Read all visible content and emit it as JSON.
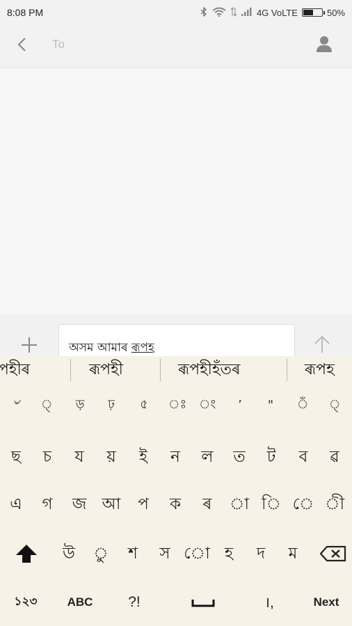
{
  "status": {
    "time": "8:08 PM",
    "network": "4G VoLTE",
    "battery_text": "50%",
    "battery_level": 0.5
  },
  "header": {
    "recipient_placeholder": "To"
  },
  "compose": {
    "text_before": "অসম আমাৰ ",
    "text_current": "ৰূপহ"
  },
  "suggestions": [
    "পহীৰ",
    "ৰূপহী",
    "ৰূপহীহঁতৰ",
    "ৰূপহ"
  ],
  "keyboard": {
    "row0": [
      "৺",
      "্",
      "ড়",
      "ঢ়",
      "৫",
      "ঃ",
      "ং",
      "’",
      "\"",
      "ঁ",
      "্"
    ],
    "row1": [
      "ছ",
      "চ",
      "য",
      "য়",
      "ই",
      "ন",
      "ল",
      "ত",
      "ট",
      "ব",
      "ৱ"
    ],
    "row2": [
      "এ",
      "গ",
      "জ",
      "আ",
      "প",
      "ক",
      "ৰ",
      "া",
      "ি",
      "ে",
      "ী"
    ],
    "row3": [
      "উ",
      "ু",
      "শ",
      "স",
      "ো",
      "হ",
      "দ",
      "ম"
    ],
    "row4": {
      "numbers": "১২৩",
      "abc": "ABC",
      "punct": "?!",
      "period_comma": "।,",
      "next": "Next"
    }
  },
  "icons": {
    "back": "chevron-left-icon",
    "contact": "person-icon",
    "attach": "plus-icon",
    "send": "arrow-up-icon",
    "shift": "shift-icon",
    "backspace": "backspace-icon",
    "space": "space-icon"
  }
}
